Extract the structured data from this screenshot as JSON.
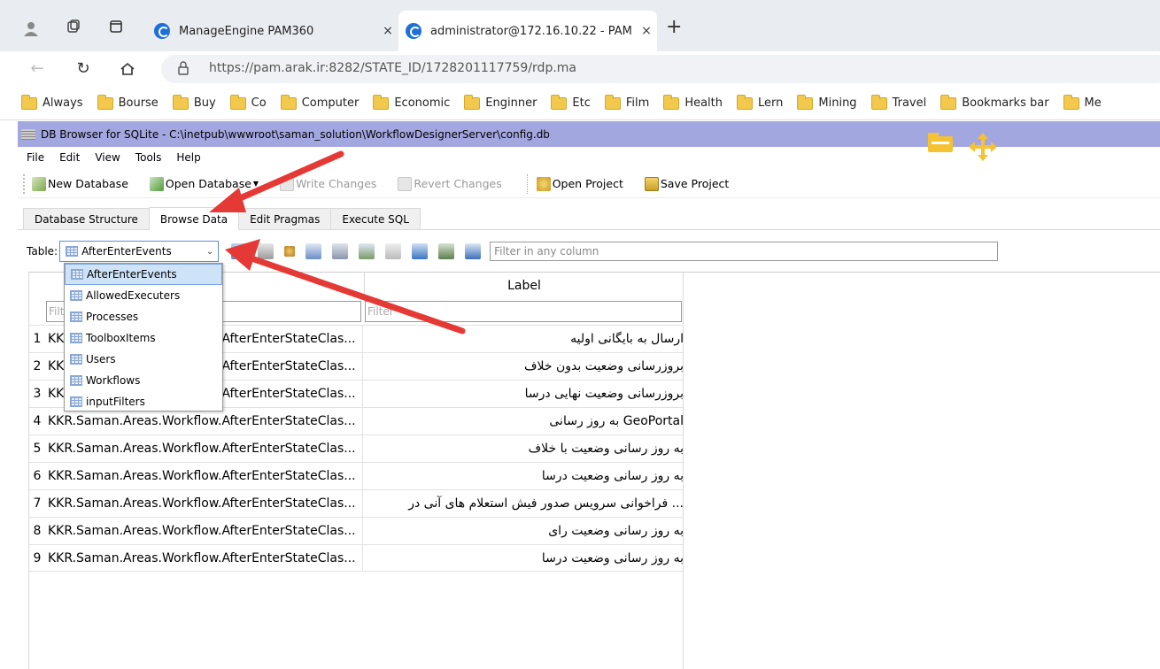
{
  "browser": {
    "tabs": [
      {
        "title": "ManageEngine PAM360",
        "close": "×"
      },
      {
        "title": "administrator@172.16.10.22 - PAM",
        "close": "×"
      }
    ],
    "new_tab": "+",
    "url": "https://pam.arak.ir:8282/STATE_ID/1728201117759/rdp.ma"
  },
  "bookmarks": [
    "Always",
    "Bourse",
    "Buy",
    "Co",
    "Computer",
    "Economic",
    "Enginner",
    "Etc",
    "Film",
    "Health",
    "Lern",
    "Mining",
    "Travel",
    "Bookmarks bar",
    "Me"
  ],
  "app": {
    "title": "DB Browser for SQLite - C:\\inetpub\\wwwroot\\saman_solution\\WorkflowDesignerServer\\config.db",
    "menu": [
      "File",
      "Edit",
      "View",
      "Tools",
      "Help"
    ],
    "toolbar": {
      "new_db": "New Database",
      "open_db": "Open Database",
      "write": "Write Changes",
      "revert": "Revert Changes",
      "open_project": "Open Project",
      "save_project": "Save Project"
    },
    "tabs": [
      "Database Structure",
      "Browse Data",
      "Edit Pragmas",
      "Execute SQL"
    ],
    "table_label": "Table:",
    "table_selected": "AfterEnterEvents",
    "filter_placeholder": "Filter in any column",
    "tables": [
      "AfterEnterEvents",
      "AllowedExecuters",
      "Processes",
      "ToolboxItems",
      "Users",
      "Workflows",
      "inputFilters"
    ],
    "columns": [
      "Name",
      "Label"
    ],
    "column_filter": "Filter",
    "rows": [
      {
        "n": "1",
        "name": "KKR.Saman.Areas.Workflow.AfterEnterStateClas...",
        "label": "ارسال به بایگانی اولیه"
      },
      {
        "n": "2",
        "name": "KKR.Saman.Areas.Workflow.AfterEnterStateClas...",
        "label": "بروزرسانی وضعیت بدون خلاف"
      },
      {
        "n": "3",
        "name": "KKR.Saman.Areas.Workflow.AfterEnterStateClas...",
        "label": "بروزرسانی وضعیت نهایی درسا"
      },
      {
        "n": "4",
        "name": "KKR.Saman.Areas.Workflow.AfterEnterStateClas...",
        "label": "GeoPortal به روز رسانی"
      },
      {
        "n": "5",
        "name": "KKR.Saman.Areas.Workflow.AfterEnterStateClas...",
        "label": "به روز رسانی وضعیت با خلاف"
      },
      {
        "n": "6",
        "name": "KKR.Saman.Areas.Workflow.AfterEnterStateClas...",
        "label": "به روز رسانی وضعیت درسا"
      },
      {
        "n": "7",
        "name": "KKR.Saman.Areas.Workflow.AfterEnterStateClas...",
        "label": "... فراخوانی سرویس صدور فیش استعلام های آنی در"
      },
      {
        "n": "8",
        "name": "KKR.Saman.Areas.Workflow.AfterEnterStateClas...",
        "label": "به روز رسانی وضعیت رای"
      },
      {
        "n": "9",
        "name": "KKR.Saman.Areas.Workflow.AfterEnterStateClas...",
        "label": "به روز رسانی وضعیت درسا"
      }
    ]
  },
  "colors": {
    "titlebar": "#a3a7e0",
    "arrow": "#e53935",
    "accent": "#1e6fd9"
  }
}
